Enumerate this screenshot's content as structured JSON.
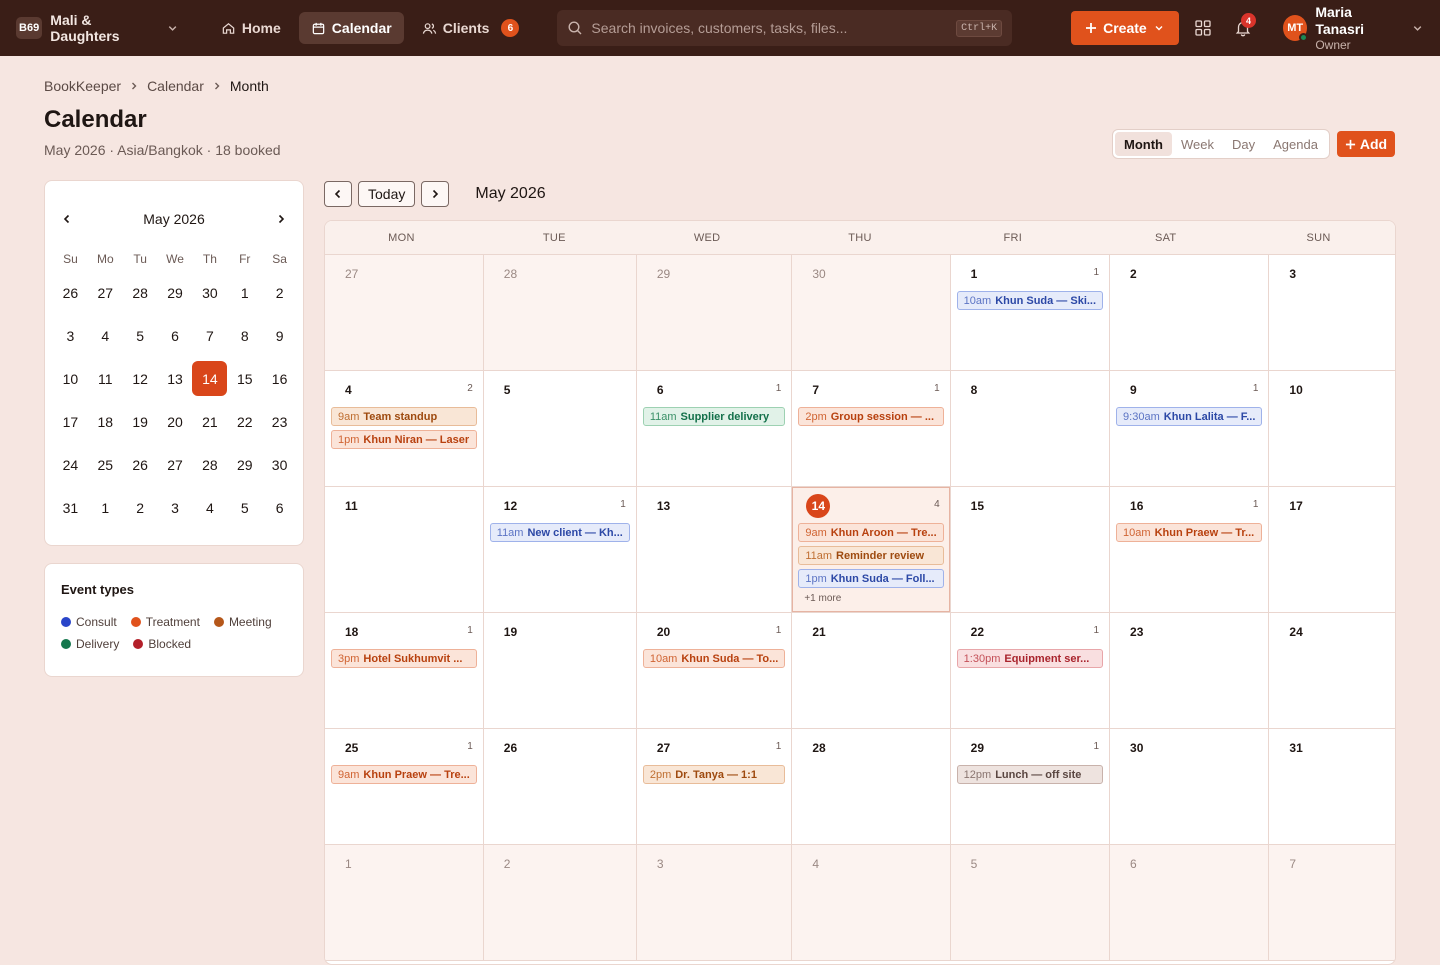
{
  "topbar": {
    "org_badge": "B69",
    "org_name": "Mali & Daughters",
    "nav": [
      {
        "label": "Home",
        "icon": "home-icon"
      },
      {
        "label": "Calendar",
        "icon": "calendar-icon",
        "active": true
      },
      {
        "label": "Clients",
        "icon": "users-icon",
        "badge": "6"
      }
    ],
    "search_placeholder": "Search invoices, customers, tasks, files...",
    "search_shortcut": "Ctrl+K",
    "create_label": "Create",
    "notif_count": "4",
    "user": {
      "initials": "MT",
      "name": "Maria Tanasri",
      "role": "Owner"
    }
  },
  "breadcrumb": [
    "BookKeeper",
    "Calendar",
    "Month"
  ],
  "page": {
    "title": "Calendar",
    "subtitle": "May 2026 · Asia/Bangkok · 18 booked"
  },
  "view_switch": [
    "Month",
    "Week",
    "Day",
    "Agenda"
  ],
  "add_label": "Add",
  "mini_cal": {
    "title": "May 2026",
    "dow": [
      "Su",
      "Mo",
      "Tu",
      "We",
      "Th",
      "Fr",
      "Sa"
    ],
    "days": [
      "26",
      "27",
      "28",
      "29",
      "30",
      "1",
      "2",
      "3",
      "4",
      "5",
      "6",
      "7",
      "8",
      "9",
      "10",
      "11",
      "12",
      "13",
      "14",
      "15",
      "16",
      "17",
      "18",
      "19",
      "20",
      "21",
      "22",
      "23",
      "24",
      "25",
      "26",
      "27",
      "28",
      "29",
      "30",
      "31",
      "1",
      "2",
      "3",
      "4",
      "5",
      "6"
    ],
    "selected_index": 18
  },
  "event_types": {
    "title": "Event types",
    "items": [
      {
        "label": "Consult",
        "color": "#2945c9"
      },
      {
        "label": "Treatment",
        "color": "#e0521c"
      },
      {
        "label": "Meeting",
        "color": "#b5571a"
      },
      {
        "label": "Delivery",
        "color": "#14774d"
      },
      {
        "label": "Blocked",
        "color": "#b3202a"
      }
    ]
  },
  "toolbar": {
    "today_label": "Today",
    "title": "May 2026"
  },
  "calendar": {
    "dow": [
      "MON",
      "TUE",
      "WED",
      "THU",
      "FRI",
      "SAT",
      "SUN"
    ],
    "cells": [
      {
        "d": "27",
        "out": true
      },
      {
        "d": "28",
        "out": true
      },
      {
        "d": "29",
        "out": true
      },
      {
        "d": "30",
        "out": true
      },
      {
        "d": "1",
        "count": "1",
        "events": [
          {
            "t": "10am",
            "n": "Khun Suda — Ski...",
            "k": "consult"
          }
        ]
      },
      {
        "d": "2"
      },
      {
        "d": "3"
      },
      {
        "d": "4",
        "count": "2",
        "events": [
          {
            "t": "9am",
            "n": "Team standup",
            "k": "meeting"
          },
          {
            "t": "1pm",
            "n": "Khun Niran — Laser",
            "k": "treatment"
          }
        ]
      },
      {
        "d": "5"
      },
      {
        "d": "6",
        "count": "1",
        "events": [
          {
            "t": "11am",
            "n": "Supplier delivery",
            "k": "delivery"
          }
        ]
      },
      {
        "d": "7",
        "count": "1",
        "events": [
          {
            "t": "2pm",
            "n": "Group session — ...",
            "k": "treatment"
          }
        ]
      },
      {
        "d": "8"
      },
      {
        "d": "9",
        "count": "1",
        "events": [
          {
            "t": "9:30am",
            "n": "Khun Lalita — F...",
            "k": "consult"
          }
        ]
      },
      {
        "d": "10"
      },
      {
        "d": "11"
      },
      {
        "d": "12",
        "count": "1",
        "events": [
          {
            "t": "11am",
            "n": "New client — Kh...",
            "k": "consult"
          }
        ]
      },
      {
        "d": "13"
      },
      {
        "d": "14",
        "count": "4",
        "today": true,
        "events": [
          {
            "t": "9am",
            "n": "Khun Aroon — Tre...",
            "k": "treatment"
          },
          {
            "t": "11am",
            "n": "Reminder review",
            "k": "meeting"
          },
          {
            "t": "1pm",
            "n": "Khun Suda — Foll...",
            "k": "consult"
          }
        ],
        "more": "+1 more"
      },
      {
        "d": "15"
      },
      {
        "d": "16",
        "count": "1",
        "events": [
          {
            "t": "10am",
            "n": "Khun Praew — Tr...",
            "k": "treatment"
          }
        ]
      },
      {
        "d": "17"
      },
      {
        "d": "18",
        "count": "1",
        "events": [
          {
            "t": "3pm",
            "n": "Hotel Sukhumvit ...",
            "k": "treatment"
          }
        ]
      },
      {
        "d": "19"
      },
      {
        "d": "20",
        "count": "1",
        "events": [
          {
            "t": "10am",
            "n": "Khun Suda — To...",
            "k": "treatment"
          }
        ]
      },
      {
        "d": "21"
      },
      {
        "d": "22",
        "count": "1",
        "events": [
          {
            "t": "1:30pm",
            "n": "Equipment ser...",
            "k": "blocked"
          }
        ]
      },
      {
        "d": "23"
      },
      {
        "d": "24"
      },
      {
        "d": "25",
        "count": "1",
        "events": [
          {
            "t": "9am",
            "n": "Khun Praew — Tre...",
            "k": "treatment"
          }
        ]
      },
      {
        "d": "26"
      },
      {
        "d": "27",
        "count": "1",
        "events": [
          {
            "t": "2pm",
            "n": "Dr. Tanya — 1:1",
            "k": "meeting"
          }
        ]
      },
      {
        "d": "28"
      },
      {
        "d": "29",
        "count": "1",
        "events": [
          {
            "t": "12pm",
            "n": "Lunch — off site",
            "k": "misc"
          }
        ]
      },
      {
        "d": "30"
      },
      {
        "d": "31"
      },
      {
        "d": "1",
        "out": true
      },
      {
        "d": "2",
        "out": true
      },
      {
        "d": "3",
        "out": true
      },
      {
        "d": "4",
        "out": true
      },
      {
        "d": "5",
        "out": true
      },
      {
        "d": "6",
        "out": true
      },
      {
        "d": "7",
        "out": true
      }
    ]
  }
}
